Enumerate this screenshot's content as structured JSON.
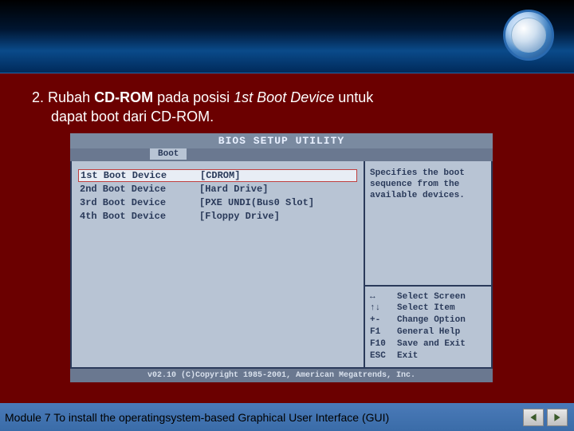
{
  "instruction": {
    "number": "2.",
    "part1": "Rubah ",
    "bold1": "CD-ROM",
    "part2": " pada posisi ",
    "italic1": "1st Boot Device",
    "part3": " untuk",
    "line2": "dapat boot dari CD-ROM."
  },
  "bios": {
    "title": "BIOS SETUP UTILITY",
    "tab": "Boot",
    "devices": [
      {
        "label": "1st Boot Device",
        "value": "[CDROM]",
        "selected": true
      },
      {
        "label": "2nd Boot Device",
        "value": "[Hard Drive]",
        "selected": false
      },
      {
        "label": "3rd Boot Device",
        "value": "[PXE UNDI(Bus0 Slot]",
        "selected": false
      },
      {
        "label": "4th Boot Device",
        "value": "[Floppy Drive]",
        "selected": false
      }
    ],
    "help": "Specifies the boot sequence from the available devices.",
    "keys": [
      {
        "k": "↔",
        "desc": "Select Screen"
      },
      {
        "k": "↑↓",
        "desc": "Select Item"
      },
      {
        "k": "+-",
        "desc": "Change Option"
      },
      {
        "k": "F1",
        "desc": "General Help"
      },
      {
        "k": "F10",
        "desc": "Save and Exit"
      },
      {
        "k": "ESC",
        "desc": "Exit"
      }
    ],
    "copyright": "v02.10 (C)Copyright 1985-2001, American Megatrends, Inc."
  },
  "footer": {
    "text": "Module 7 To install the operatingsystem-based Graphical User Interface (GUI)"
  }
}
